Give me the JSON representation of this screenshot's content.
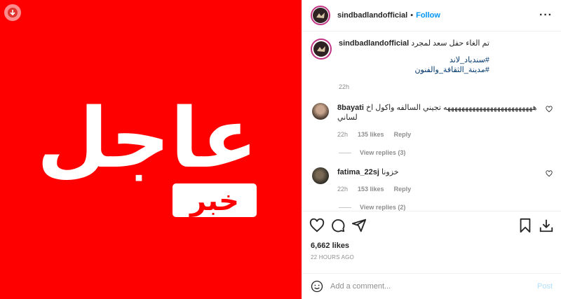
{
  "post": {
    "username": "sindbadlandofficial",
    "separator": "•",
    "follow_label": "Follow",
    "more_label": "···",
    "media": {
      "headline": "عاجل",
      "badge": "خبر",
      "colors": {
        "background": "#fe0000",
        "text": "#ffffff"
      }
    },
    "caption": {
      "username": "sindbadlandofficial",
      "text": "تم الغاء حفل سعد لمجرد",
      "hashtags": [
        "#سندباد_لاند",
        "#مدينة_الثقافة_والفنون"
      ],
      "age": "22h"
    },
    "comments": [
      {
        "username": "8bayati",
        "text": "هههههههههههههههههههههههههه تجيني السالفه واكول اخ لساني",
        "age": "22h",
        "likes": "135 likes",
        "reply_label": "Reply",
        "view_replies": "View replies (3)"
      },
      {
        "username": "fatima_22sj",
        "text": "خزونا",
        "age": "22h",
        "likes": "153 likes",
        "reply_label": "Reply",
        "view_replies": "View replies (2)"
      }
    ],
    "likes_count": "6,662 likes",
    "timestamp": "22 HOURS AGO",
    "add_comment_placeholder": "Add a comment...",
    "post_label": "Post",
    "colors": {
      "accent": "#0095f6",
      "post_disabled": "#b2dffc",
      "hashtag": "#00376b"
    }
  }
}
